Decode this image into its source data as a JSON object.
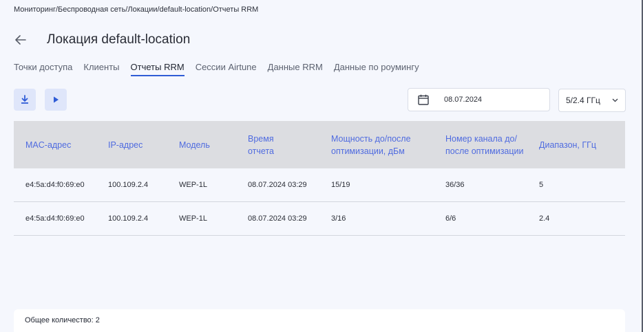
{
  "breadcrumb": "Мониторинг/Беспроводная сеть/Локации/default-location/Отчеты RRM",
  "page_title": "Локация default-location",
  "tabs": [
    {
      "label": "Точки доступа"
    },
    {
      "label": "Клиенты"
    },
    {
      "label": "Отчеты RRM"
    },
    {
      "label": "Сессии Airtune"
    },
    {
      "label": "Данные RRM"
    },
    {
      "label": "Данные по роумингу"
    }
  ],
  "active_tab": "Отчеты RRM",
  "date_filter": {
    "value": "08.07.2024"
  },
  "band_select": {
    "value": "5/2.4 ГГц"
  },
  "table": {
    "headers": {
      "mac": "MAC-адрес",
      "ip": "IP-адрес",
      "model": "Модель",
      "time": "Время отчета",
      "power": "Мощность до/после оптимизации, дБм",
      "channel": "Номер канала до/после оптимизации",
      "band": "Диапазон, ГГц"
    },
    "rows": [
      {
        "mac": "e4:5a:d4:f0:69:e0",
        "ip": "100.109.2.4",
        "model": "WEP-1L",
        "time": "08.07.2024 03:29",
        "power": "15/19",
        "channel": "36/36",
        "band": "5"
      },
      {
        "mac": "e4:5a:d4:f0:69:e0",
        "ip": "100.109.2.4",
        "model": "WEP-1L",
        "time": "08.07.2024 03:29",
        "power": "3/16",
        "channel": "6/6",
        "band": "2.4"
      }
    ]
  },
  "footer": {
    "total": "Общее количество: 2"
  },
  "colors": {
    "accent": "#2f5cd6",
    "header_text": "#4f6be0",
    "icon_button_bg": "#dfe6fa"
  }
}
